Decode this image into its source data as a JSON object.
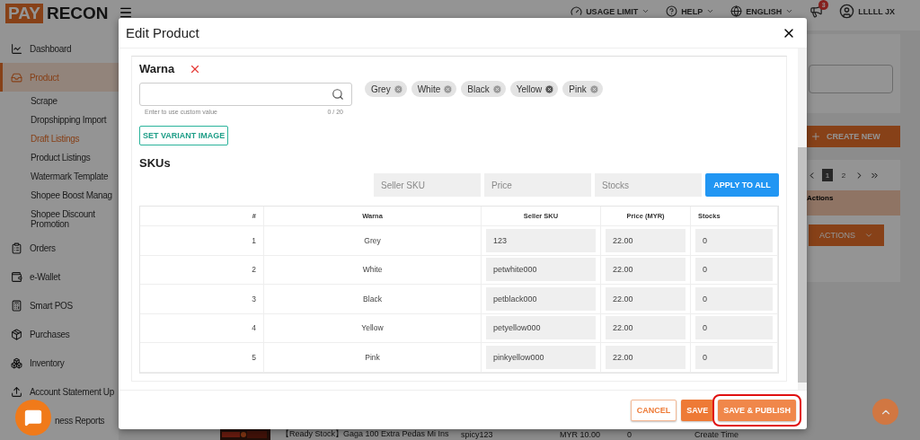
{
  "logo": {
    "part_1": "PAY",
    "part_2": "RECON"
  },
  "header": {
    "menus": [
      {
        "label": "USAGE LIMIT"
      },
      {
        "label": "HELP"
      },
      {
        "label": "ENGLISH"
      }
    ],
    "notification_count": "3",
    "user": "LLLLL JX"
  },
  "sidebar": {
    "items": [
      {
        "label": "Dashboard",
        "selected": false
      },
      {
        "label": "Product",
        "selected": true,
        "children": [
          {
            "label": "Scrape",
            "selected": false
          },
          {
            "label": "Dropshipping Import",
            "selected": false
          },
          {
            "label": "Draft Listings",
            "selected": true
          },
          {
            "label": "Product Listings",
            "selected": false
          },
          {
            "label": "Watermark Template",
            "selected": false
          },
          {
            "label": "Shopee Boost Manag",
            "selected": false
          },
          {
            "label": "Shopee Discount Promotion",
            "selected": false
          }
        ]
      },
      {
        "label": "Orders",
        "selected": false
      },
      {
        "label": "e-Wallet",
        "selected": false
      },
      {
        "label": "Smart POS",
        "selected": false
      },
      {
        "label": "Purchases",
        "selected": false
      },
      {
        "label": "Inventory",
        "selected": false
      },
      {
        "label": "Account Statement Up",
        "selected": false
      },
      {
        "label": "ness Reports",
        "selected": false
      }
    ]
  },
  "page": {
    "create_button": "CREATE NEW",
    "pagination": [
      {
        "label": "1",
        "selected": true
      },
      {
        "label": "2",
        "selected": false
      }
    ],
    "table_header": "Actions",
    "actions_button": "ACTIONS",
    "bottom_row": [
      "【Ready Stock】Gaga 100 Extra Pedas Mi Ins",
      "spicy123",
      "MYR 10.00",
      "0",
      "Create Time"
    ]
  },
  "modal": {
    "title": "Edit Product",
    "variation": {
      "name": "Warna",
      "hint": "Enter to use custom value",
      "counter": "0 / 20",
      "options": [
        {
          "label": "Grey",
          "hovered": false
        },
        {
          "label": "White",
          "hovered": false
        },
        {
          "label": "Black",
          "hovered": false
        },
        {
          "label": "Yellow",
          "hovered": true
        },
        {
          "label": "Pink",
          "hovered": false
        }
      ]
    },
    "set_image_button": "SET VARIANT IMAGE",
    "skus": {
      "title": "SKUs",
      "bulk_fields": [
        {
          "placeholder": "Seller SKU"
        },
        {
          "placeholder": "Price"
        },
        {
          "placeholder": "Stocks"
        }
      ],
      "apply_button": "APPLY TO ALL",
      "columns": [
        "#",
        "Warna",
        "Seller SKU",
        "Price (MYR)",
        "Stocks"
      ],
      "rows": [
        {
          "index": "1",
          "warna": "Grey",
          "seller_sku": "123",
          "price": "22.00",
          "stocks": "0"
        },
        {
          "index": "2",
          "warna": "White",
          "seller_sku": "petwhite000",
          "price": "22.00",
          "stocks": "0"
        },
        {
          "index": "3",
          "warna": "Black",
          "seller_sku": "petblack000",
          "price": "22.00",
          "stocks": "0"
        },
        {
          "index": "4",
          "warna": "Yellow",
          "seller_sku": "petyellow000",
          "price": "22.00",
          "stocks": "0"
        },
        {
          "index": "5",
          "warna": "Pink",
          "seller_sku": "pinkyellow000",
          "price": "22.00",
          "stocks": "0"
        }
      ]
    },
    "buttons": [
      {
        "label": "CANCEL",
        "kind": "outline",
        "highlighted": false
      },
      {
        "label": "SAVE",
        "kind": "filled",
        "highlighted": false
      },
      {
        "label": "SAVE & PUBLISH",
        "kind": "primary",
        "highlighted": true
      }
    ]
  }
}
